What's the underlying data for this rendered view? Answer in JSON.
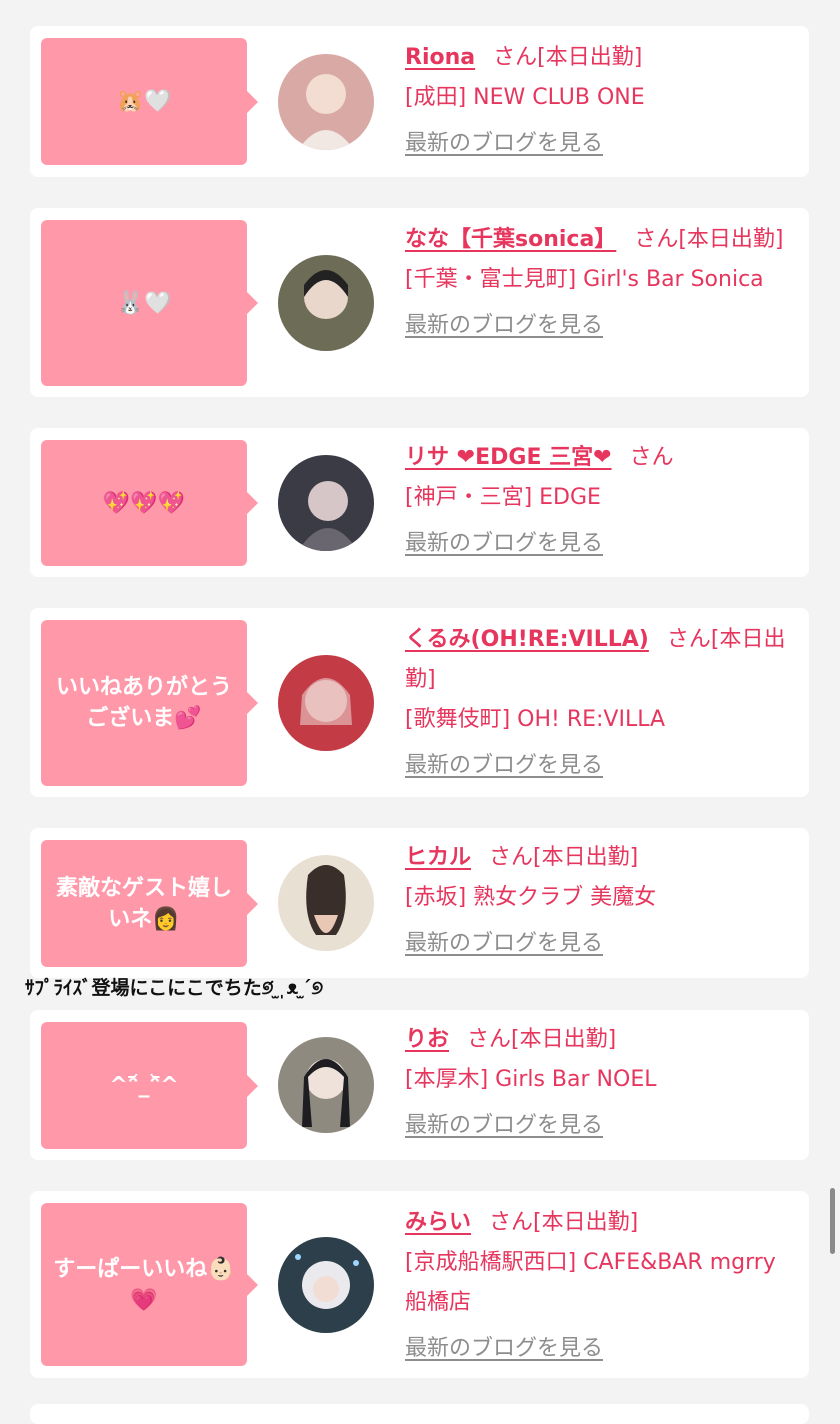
{
  "suffix_san": "さん",
  "blog_link_label": "最新のブログを見る",
  "floating_text": "ｻﾌﾟﾗｲｽﾞ登場にこにこでちた୭́ ̫ ̩ᴥ ̫ ́୭",
  "cards": [
    {
      "bubble": "🐹🤍",
      "name": "Riona",
      "status": "[本日出勤]",
      "shop": "[成田] NEW CLUB ONE",
      "avatar_color": "#d9a9a6"
    },
    {
      "bubble": "🐰🤍",
      "name": "なな【千葉sonica】",
      "status": "[本日出勤]",
      "shop": "[千葉・富士見町] Girl's Bar Sonica",
      "avatar_color": "#6d6c56"
    },
    {
      "bubble": "💖💖💖",
      "name": "リサ ❤EDGE 三宮❤",
      "status": "",
      "shop": "[神戸・三宮] EDGE",
      "avatar_color": "#3b3b45"
    },
    {
      "bubble": "いいねありがとうございま💕",
      "name": "くるみ(OH!RE:VILLA)",
      "status": "[本日出勤]",
      "shop": "[歌舞伎町] OH! RE:VILLA",
      "avatar_color": "#c23b45"
    },
    {
      "bubble": "素敵なゲスト嬉しいネ👩",
      "name": "ヒカル",
      "status": "[本日出勤]",
      "shop": "[赤坂] 熟女クラブ 美魔女",
      "avatar_color": "#e9e0d4"
    },
    {
      "bubble": "^ᵔ᷄_ᵔ᷅^",
      "name": "りお",
      "status": "[本日出勤]",
      "shop": "[本厚木] Girls Bar NOEL",
      "avatar_color": "#8f8a80"
    },
    {
      "bubble": "すーぱーいいね👶🏻💗",
      "name": "みらい",
      "status": "[本日出勤]",
      "shop": "[京成船橋駅西口] CAFE&BAR mgrry 船橋店",
      "avatar_color": "#2d3f4a"
    }
  ]
}
